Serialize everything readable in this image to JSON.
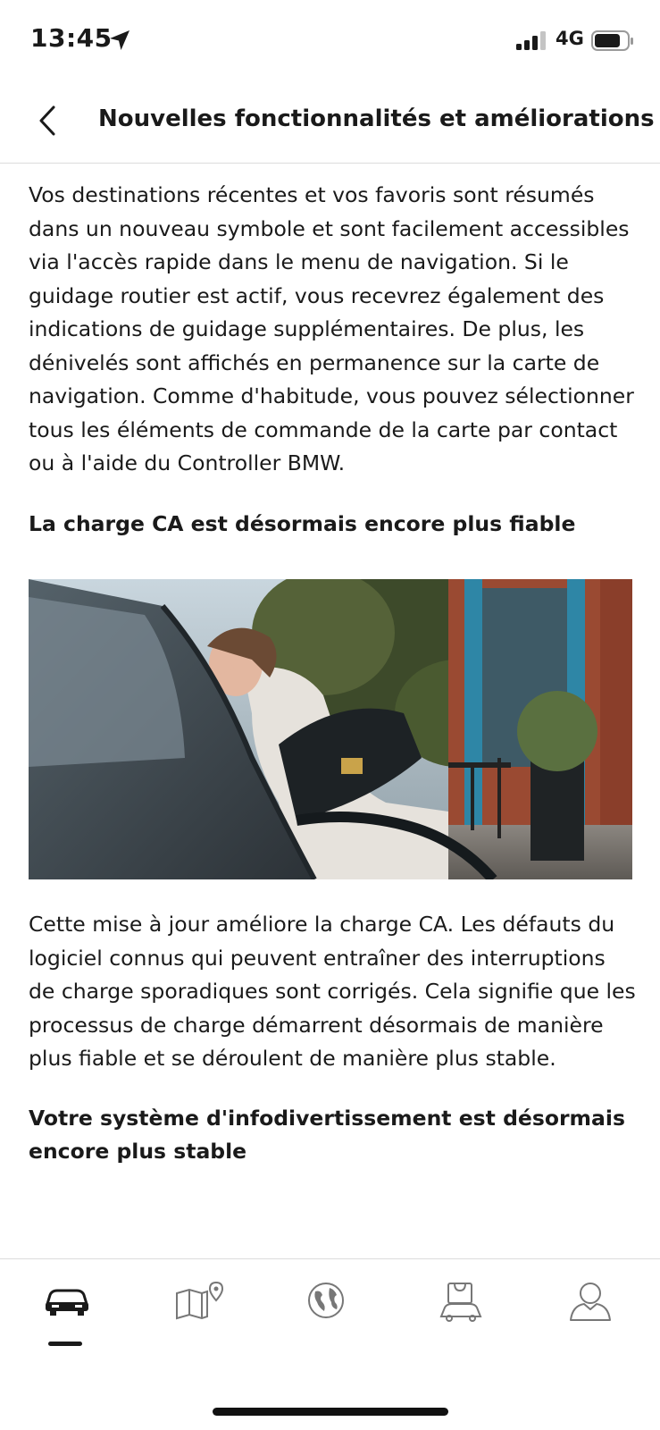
{
  "status_bar": {
    "time": "13:45",
    "network": "4G",
    "icons": [
      "location-arrow-icon",
      "signal-icon",
      "battery-icon"
    ]
  },
  "header": {
    "title": "Nouvelles fonctionnalités et améliorations",
    "back_icon": "chevron-left-icon"
  },
  "article": {
    "paragraph_1": "Vos destinations récentes et vos favoris sont résumés dans un nouveau symbole et sont facilement accessibles via l'accès rapide dans le menu de navigation. Si le guidage routier est actif, vous recevrez également des indications de guidage supplémentaires. De plus, les dénivelés sont affichés en permanence sur la carte de navigation. Comme d'habitude, vous pouvez sélectionner tous les éléments de commande de la carte par contact ou à l'aide du Controller BMW.",
    "heading_1": "La charge CA est désormais encore plus fiable",
    "paragraph_2": "Cette mise à jour améliore la charge CA. Les défauts du logiciel connus qui peuvent entraîner des interruptions de charge sporadiques sont corrigés. Cela signifie que les processus de charge démarrent désormais de manière plus fiable et se déroulent de manière plus stable.",
    "heading_2": "Votre système d'infodivertissement est désormais encore plus stable"
  },
  "tab_bar": {
    "items": [
      {
        "icon": "car-icon",
        "active": true
      },
      {
        "icon": "map-pin-icon",
        "active": false
      },
      {
        "icon": "globe-icon",
        "active": false
      },
      {
        "icon": "shopping-bag-car-icon",
        "active": false
      },
      {
        "icon": "user-profile-icon",
        "active": false
      }
    ]
  },
  "colors": {
    "text": "#1a1a1a",
    "divider": "#dcdcdc",
    "background": "#ffffff"
  }
}
